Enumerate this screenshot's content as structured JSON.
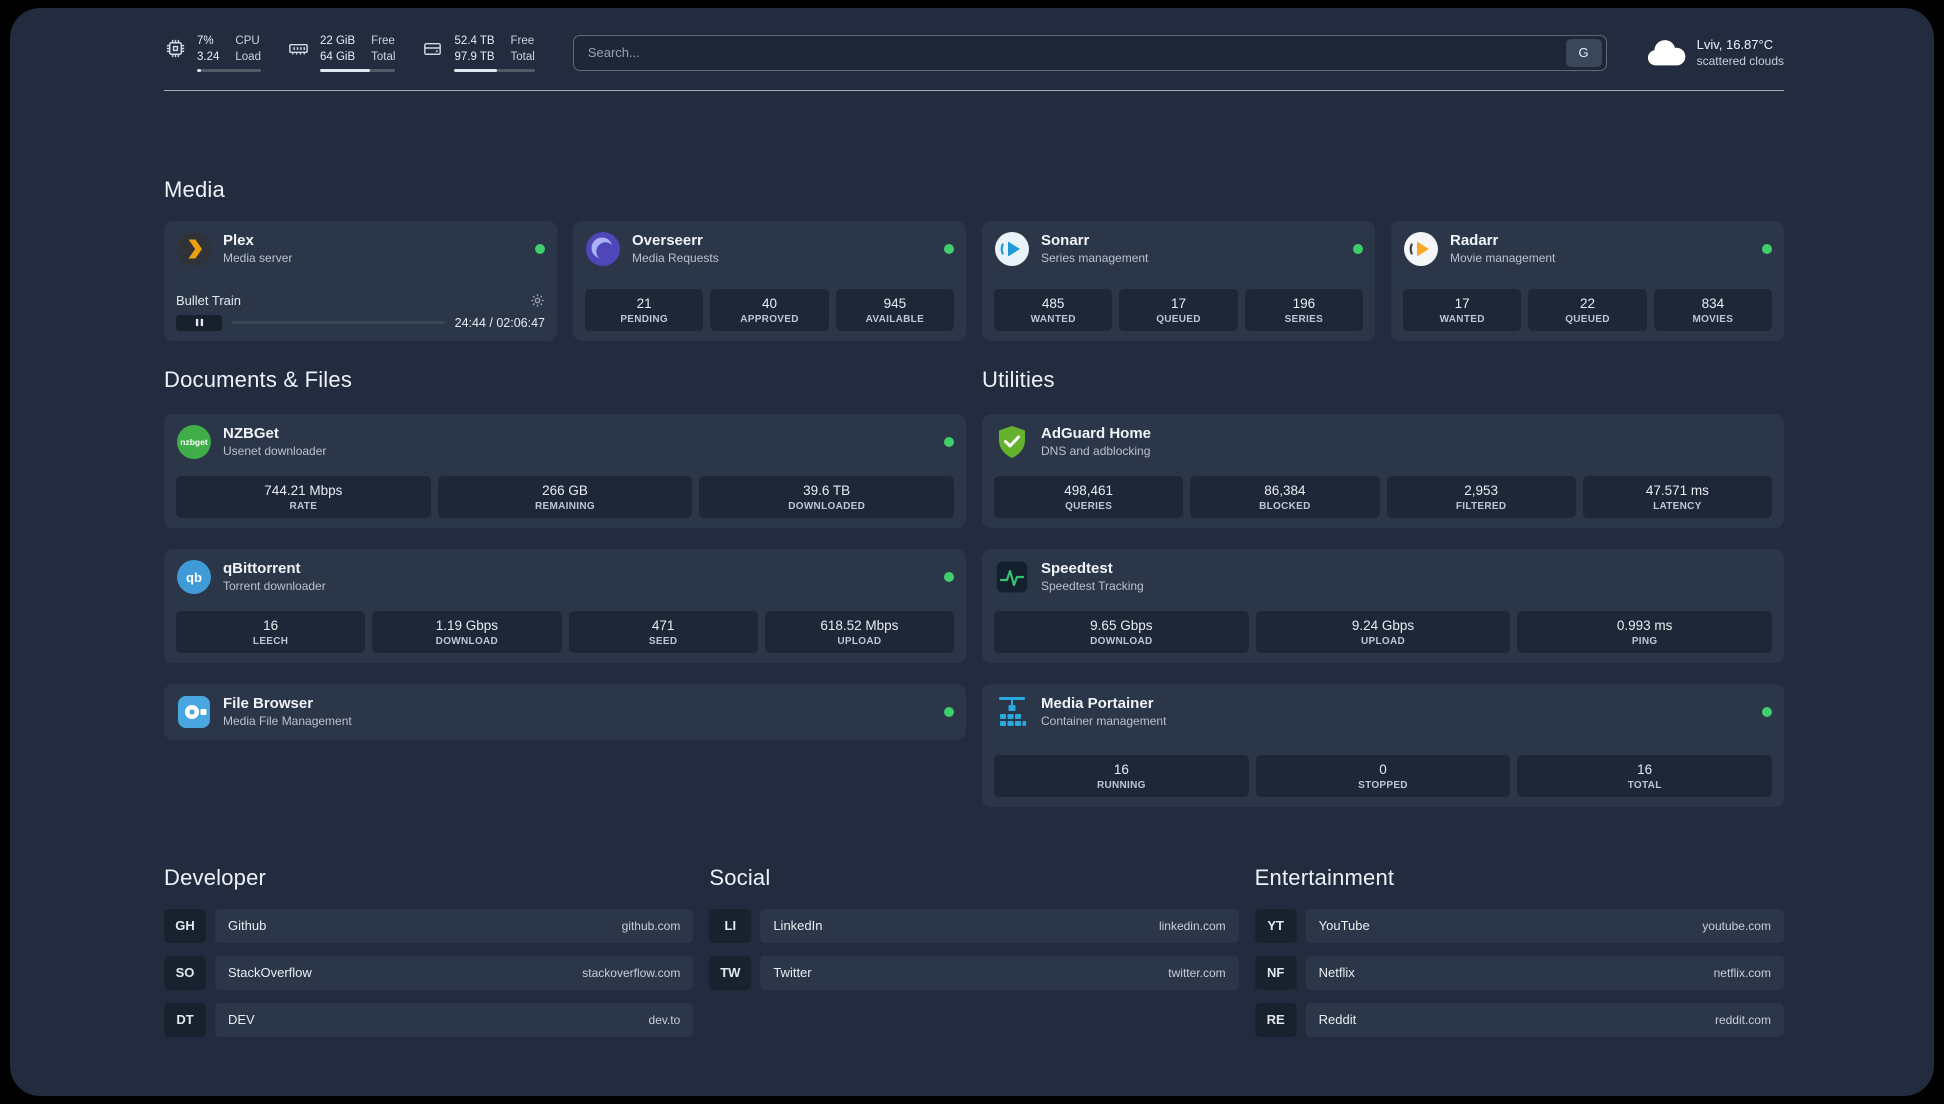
{
  "colors": {
    "panel_bg": "#222c3e",
    "card_bg": "#2b3649",
    "stat_bg": "#1d2737",
    "status_online": "#3ecf6a"
  },
  "topbar": {
    "cpu": {
      "icon": "cpu-icon",
      "value1": "7%",
      "label1": "CPU",
      "value2": "3.24",
      "label2": "Load"
    },
    "memory": {
      "icon": "memory-icon",
      "value1": "22 GiB",
      "label1": "Free",
      "value2": "64 GiB",
      "label2": "Total"
    },
    "disk": {
      "icon": "disk-icon",
      "value1": "52.4 TB",
      "label1": "Free",
      "value2": "97.9 TB",
      "label2": "Total"
    },
    "search": {
      "placeholder": "Search...",
      "button_label": "G"
    },
    "weather": {
      "icon": "cloud-icon",
      "location": "Lviv, 16.87°C",
      "condition": "scattered clouds"
    }
  },
  "media": {
    "title": "Media",
    "cards": [
      {
        "name": "Plex",
        "subtitle": "Media server",
        "icon": "plex-icon",
        "online": true,
        "player": {
          "track": "Bullet Train",
          "time": "24:44 / 02:06:47"
        }
      },
      {
        "name": "Overseerr",
        "subtitle": "Media Requests",
        "icon": "overseerr-icon",
        "online": true,
        "stats": [
          {
            "value": "21",
            "label": "PENDING"
          },
          {
            "value": "40",
            "label": "APPROVED"
          },
          {
            "value": "945",
            "label": "AVAILABLE"
          }
        ]
      },
      {
        "name": "Sonarr",
        "subtitle": "Series management",
        "icon": "sonarr-icon",
        "online": true,
        "stats": [
          {
            "value": "485",
            "label": "WANTED"
          },
          {
            "value": "17",
            "label": "QUEUED"
          },
          {
            "value": "196",
            "label": "SERIES"
          }
        ]
      },
      {
        "name": "Radarr",
        "subtitle": "Movie management",
        "icon": "radarr-icon",
        "online": true,
        "stats": [
          {
            "value": "17",
            "label": "WANTED"
          },
          {
            "value": "22",
            "label": "QUEUED"
          },
          {
            "value": "834",
            "label": "MOVIES"
          }
        ]
      }
    ]
  },
  "documents": {
    "title": "Documents & Files",
    "cards": [
      {
        "name": "NZBGet",
        "subtitle": "Usenet downloader",
        "icon": "nzbget-icon",
        "online": true,
        "stats": [
          {
            "value": "744.21 Mbps",
            "label": "RATE"
          },
          {
            "value": "266 GB",
            "label": "REMAINING"
          },
          {
            "value": "39.6 TB",
            "label": "DOWNLOADED"
          }
        ]
      },
      {
        "name": "qBittorrent",
        "subtitle": "Torrent downloader",
        "icon": "qbittorrent-icon",
        "online": true,
        "stats": [
          {
            "value": "16",
            "label": "LEECH"
          },
          {
            "value": "1.19 Gbps",
            "label": "DOWNLOAD"
          },
          {
            "value": "471",
            "label": "SEED"
          },
          {
            "value": "618.52 Mbps",
            "label": "UPLOAD"
          }
        ]
      },
      {
        "name": "File Browser",
        "subtitle": "Media File Management",
        "icon": "filebrowser-icon",
        "online": true
      }
    ]
  },
  "utilities": {
    "title": "Utilities",
    "cards": [
      {
        "name": "AdGuard Home",
        "subtitle": "DNS and adblocking",
        "icon": "adguard-icon",
        "online": false,
        "stats": [
          {
            "value": "498,461",
            "label": "QUERIES"
          },
          {
            "value": "86,384",
            "label": "BLOCKED"
          },
          {
            "value": "2,953",
            "label": "FILTERED"
          },
          {
            "value": "47.571 ms",
            "label": "LATENCY"
          }
        ]
      },
      {
        "name": "Speedtest",
        "subtitle": "Speedtest Tracking",
        "icon": "speedtest-icon",
        "online": false,
        "stats": [
          {
            "value": "9.65 Gbps",
            "label": "DOWNLOAD"
          },
          {
            "value": "9.24 Gbps",
            "label": "UPLOAD"
          },
          {
            "value": "0.993 ms",
            "label": "PING"
          }
        ]
      },
      {
        "name": "Media Portainer",
        "subtitle": "Container management",
        "icon": "portainer-icon",
        "online": true,
        "stats": [
          {
            "value": "16",
            "label": "RUNNING"
          },
          {
            "value": "0",
            "label": "STOPPED"
          },
          {
            "value": "16",
            "label": "TOTAL"
          }
        ]
      }
    ]
  },
  "bookmarks": [
    {
      "title": "Developer",
      "items": [
        {
          "abbr": "GH",
          "name": "Github",
          "url": "github.com"
        },
        {
          "abbr": "SO",
          "name": "StackOverflow",
          "url": "stackoverflow.com"
        },
        {
          "abbr": "DT",
          "name": "DEV",
          "url": "dev.to"
        }
      ]
    },
    {
      "title": "Social",
      "items": [
        {
          "abbr": "LI",
          "name": "LinkedIn",
          "url": "linkedin.com"
        },
        {
          "abbr": "TW",
          "name": "Twitter",
          "url": "twitter.com"
        }
      ]
    },
    {
      "title": "Entertainment",
      "items": [
        {
          "abbr": "YT",
          "name": "YouTube",
          "url": "youtube.com"
        },
        {
          "abbr": "NF",
          "name": "Netflix",
          "url": "netflix.com"
        },
        {
          "abbr": "RE",
          "name": "Reddit",
          "url": "reddit.com"
        }
      ]
    }
  ]
}
